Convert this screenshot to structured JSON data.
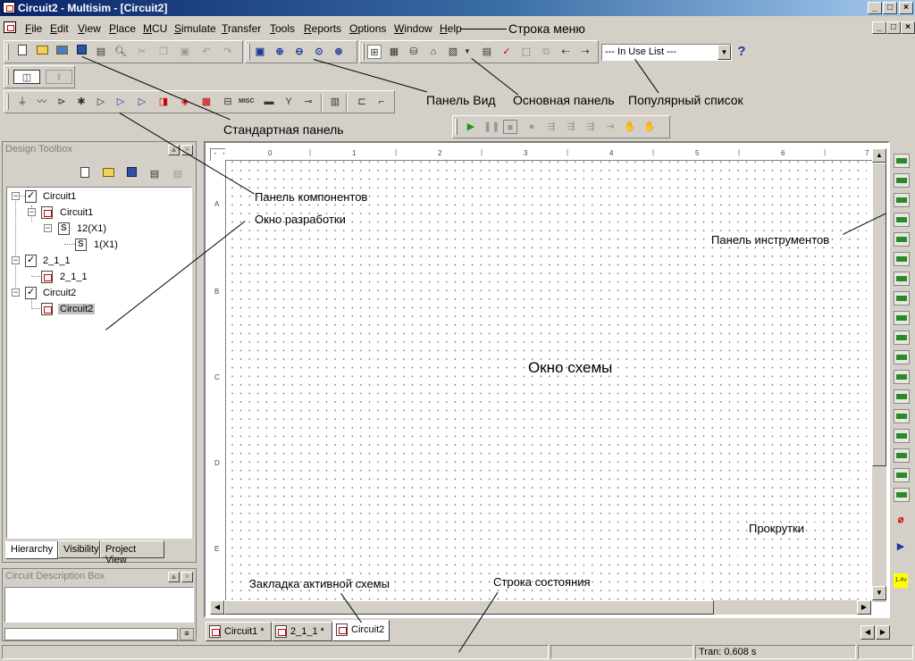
{
  "window": {
    "title": "Circuit2 - Multisim - [Circuit2]"
  },
  "menu": [
    "File",
    "Edit",
    "View",
    "Place",
    "MCU",
    "Simulate",
    "Transfer",
    "Tools",
    "Reports",
    "Options",
    "Window",
    "Help"
  ],
  "in_use_list": {
    "value": "--- In Use List ---"
  },
  "design_toolbox": {
    "title": "Design Toolbox",
    "tree": [
      {
        "label": "Circuit1"
      },
      {
        "label": "Circuit1"
      },
      {
        "label": "12(X1)"
      },
      {
        "label": "1(X1)"
      },
      {
        "label": "2_1_1"
      },
      {
        "label": "2_1_1"
      },
      {
        "label": "Circuit2"
      },
      {
        "label": "Circuit2"
      }
    ],
    "tabs": [
      "Hierarchy",
      "Visibility",
      "Project View"
    ]
  },
  "description_box": {
    "title": "Circuit Description Box"
  },
  "schematic": {
    "ruler_x": [
      "0",
      "1",
      "2",
      "3",
      "4",
      "5",
      "6",
      "7"
    ],
    "ruler_y": [
      "A",
      "B",
      "C",
      "D",
      "E"
    ],
    "tabs": [
      "Circuit1 *",
      "2_1_1 *",
      "Circuit2"
    ]
  },
  "status": {
    "sim_time": "Tran: 0.608 s"
  },
  "annotations": {
    "menu_bar": "Строка меню",
    "view_panel": "Панель Вид",
    "main_panel": "Основная панель",
    "popular_list": "Популярный список",
    "standard_panel": "Стандартная панель",
    "components_panel": "Панель компонентов",
    "design_window": "Окно разработки",
    "instruments_panel": "Панель инструментов",
    "schematic_window": "Окно схемы",
    "scrollbars": "Прокрутки",
    "active_tab": "Закладка активной схемы",
    "status_bar": "Строка состояния"
  }
}
